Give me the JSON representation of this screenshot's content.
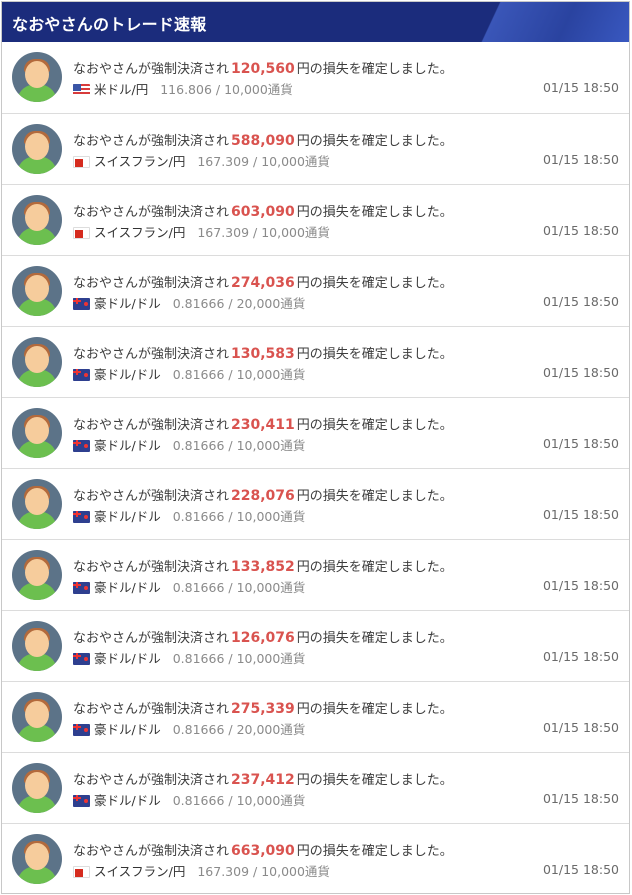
{
  "header": {
    "title": "なおやさんのトレード速報",
    "colors": {
      "background": "#1b2c7c",
      "accent": "#3a56b8"
    }
  },
  "colors": {
    "amount": "#d9534f",
    "avatar_bg": "#5c7388"
  },
  "items": [
    {
      "prefix": "なおやさんが強制決済され",
      "amount": "120,560",
      "suffix": "円の損失を確定しました。",
      "flag": "us-flag",
      "pair": "米ドル/円",
      "rate": "116.806 / 10,000通貨",
      "time": "01/15 18:50"
    },
    {
      "prefix": "なおやさんが強制決済され",
      "amount": "588,090",
      "suffix": "円の損失を確定しました。",
      "flag": "ch-flag",
      "pair": "スイスフラン/円",
      "rate": "167.309 / 10,000通貨",
      "time": "01/15 18:50"
    },
    {
      "prefix": "なおやさんが強制決済され",
      "amount": "603,090",
      "suffix": "円の損失を確定しました。",
      "flag": "ch-flag",
      "pair": "スイスフラン/円",
      "rate": "167.309 / 10,000通貨",
      "time": "01/15 18:50"
    },
    {
      "prefix": "なおやさんが強制決済され",
      "amount": "274,036",
      "suffix": "円の損失を確定しました。",
      "flag": "au-flag",
      "pair": "豪ドル/ドル",
      "rate": "0.81666 / 20,000通貨",
      "time": "01/15 18:50"
    },
    {
      "prefix": "なおやさんが強制決済され",
      "amount": "130,583",
      "suffix": "円の損失を確定しました。",
      "flag": "au-flag",
      "pair": "豪ドル/ドル",
      "rate": "0.81666 / 10,000通貨",
      "time": "01/15 18:50"
    },
    {
      "prefix": "なおやさんが強制決済され",
      "amount": "230,411",
      "suffix": "円の損失を確定しました。",
      "flag": "au-flag",
      "pair": "豪ドル/ドル",
      "rate": "0.81666 / 10,000通貨",
      "time": "01/15 18:50"
    },
    {
      "prefix": "なおやさんが強制決済され",
      "amount": "228,076",
      "suffix": "円の損失を確定しました。",
      "flag": "au-flag",
      "pair": "豪ドル/ドル",
      "rate": "0.81666 / 10,000通貨",
      "time": "01/15 18:50"
    },
    {
      "prefix": "なおやさんが強制決済され",
      "amount": "133,852",
      "suffix": "円の損失を確定しました。",
      "flag": "au-flag",
      "pair": "豪ドル/ドル",
      "rate": "0.81666 / 10,000通貨",
      "time": "01/15 18:50"
    },
    {
      "prefix": "なおやさんが強制決済され",
      "amount": "126,076",
      "suffix": "円の損失を確定しました。",
      "flag": "au-flag",
      "pair": "豪ドル/ドル",
      "rate": "0.81666 / 10,000通貨",
      "time": "01/15 18:50"
    },
    {
      "prefix": "なおやさんが強制決済され",
      "amount": "275,339",
      "suffix": "円の損失を確定しました。",
      "flag": "au-flag",
      "pair": "豪ドル/ドル",
      "rate": "0.81666 / 20,000通貨",
      "time": "01/15 18:50"
    },
    {
      "prefix": "なおやさんが強制決済され",
      "amount": "237,412",
      "suffix": "円の損失を確定しました。",
      "flag": "au-flag",
      "pair": "豪ドル/ドル",
      "rate": "0.81666 / 10,000通貨",
      "time": "01/15 18:50"
    },
    {
      "prefix": "なおやさんが強制決済され",
      "amount": "663,090",
      "suffix": "円の損失を確定しました。",
      "flag": "ch-flag",
      "pair": "スイスフラン/円",
      "rate": "167.309 / 10,000通貨",
      "time": "01/15 18:50"
    }
  ]
}
